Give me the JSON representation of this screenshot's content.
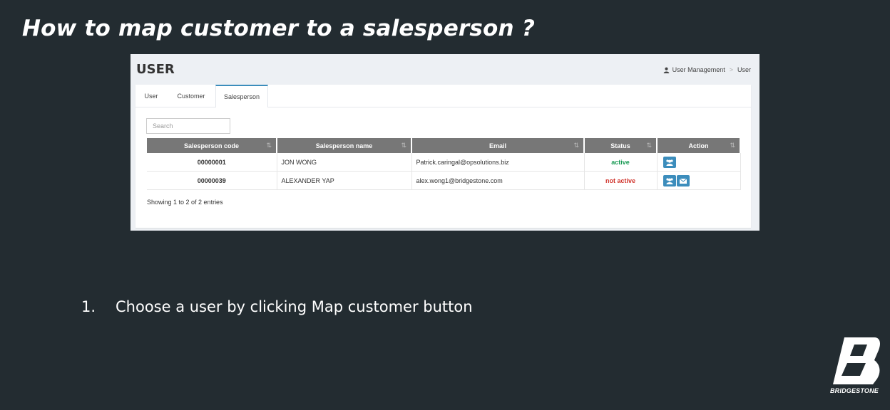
{
  "slide": {
    "title": "How to map customer to a salesperson ?",
    "instruction_number": "1.",
    "instruction_text": "Choose a user by clicking Map customer button",
    "brand_name": "BRIDGESTONE"
  },
  "app": {
    "page_title": "USER",
    "breadcrumb": [
      "User Management",
      "User"
    ],
    "tabs": [
      "User",
      "Customer",
      "Salesperson"
    ],
    "active_tab": "Salesperson",
    "search_placeholder": "Search",
    "columns": [
      "Salesperson code",
      "Salesperson name",
      "Email",
      "Status",
      "Action"
    ],
    "rows": [
      {
        "code": "00000001",
        "name": "JON WONG",
        "email": "Patrick.caringal@opsolutions.biz",
        "status": "active",
        "actions": [
          "map-customer-icon"
        ]
      },
      {
        "code": "00000039",
        "name": "ALEXANDER YAP",
        "email": "alex.wong1@bridgestone.com",
        "status": "not active",
        "actions": [
          "map-customer-icon",
          "envelope-icon"
        ]
      }
    ],
    "showing": "Showing 1 to 2 of 2 entries",
    "colors": {
      "accent": "#3c8dbc",
      "active": "#1a9b55",
      "inactive": "#d0342c",
      "header": "#777777"
    }
  }
}
